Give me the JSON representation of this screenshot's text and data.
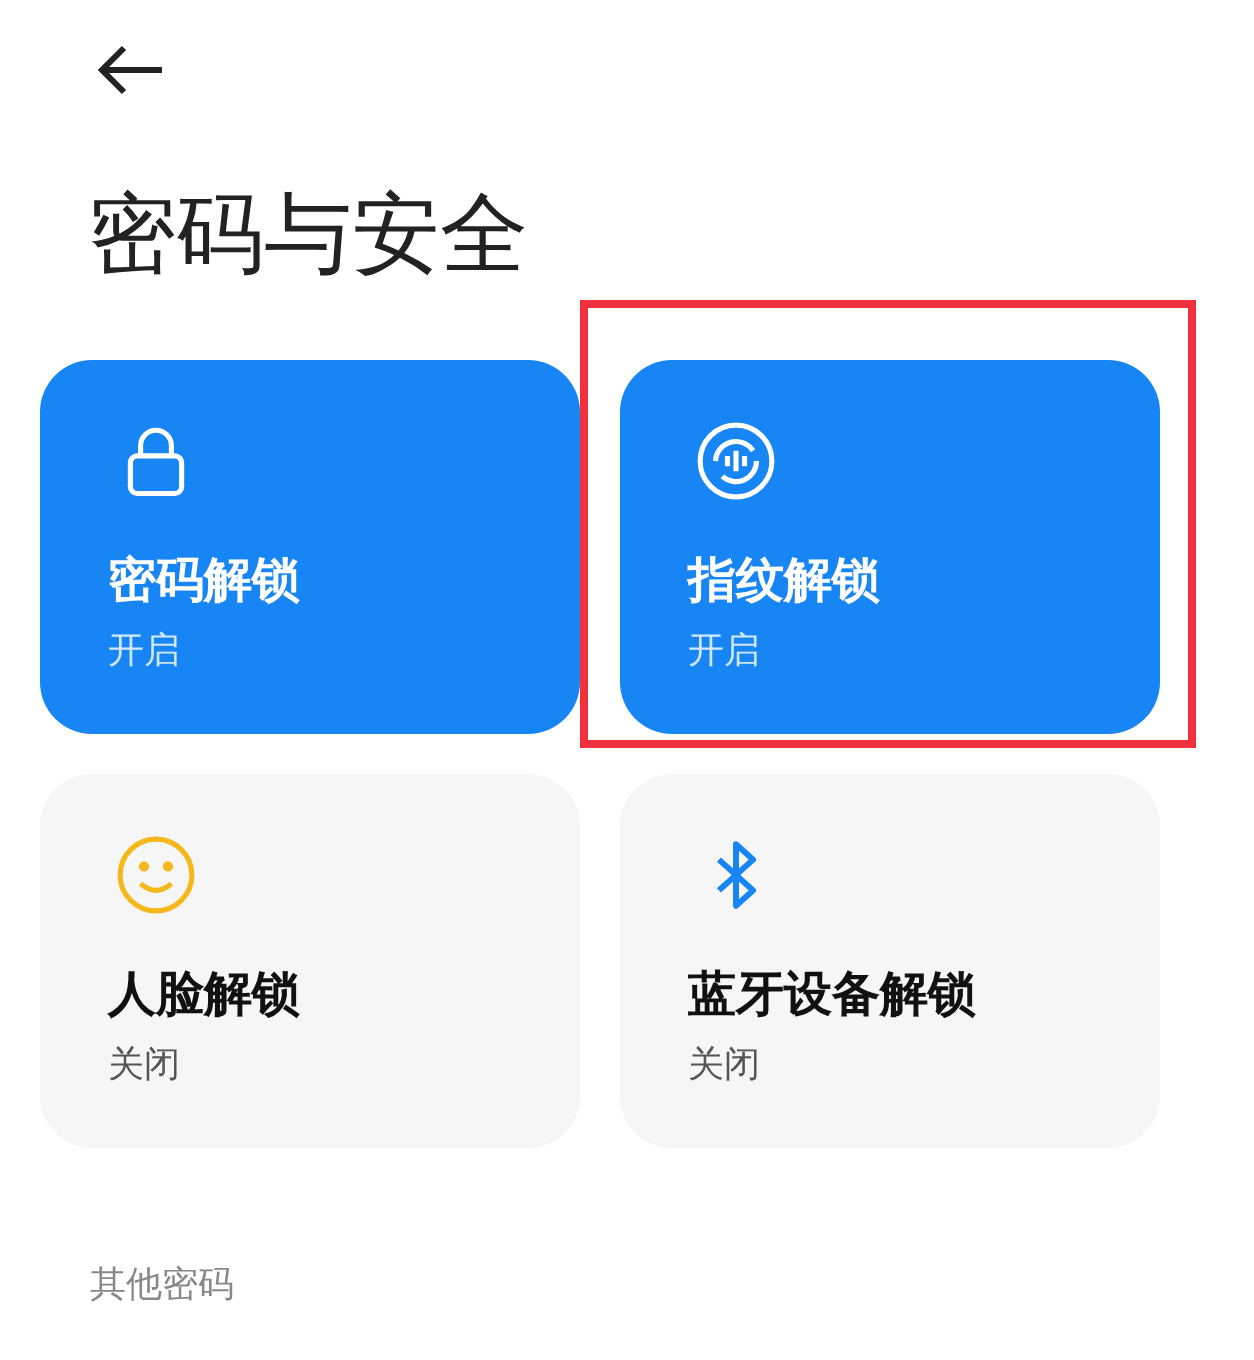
{
  "title": "密码与安全",
  "cards": [
    {
      "kind": "lock",
      "label": "密码解锁",
      "status": "开启",
      "on": true,
      "highlighted": false
    },
    {
      "kind": "fingerprint",
      "label": "指纹解锁",
      "status": "开启",
      "on": true,
      "highlighted": true
    },
    {
      "kind": "face",
      "label": "人脸解锁",
      "status": "关闭",
      "on": false,
      "highlighted": false
    },
    {
      "kind": "bluetooth",
      "label": "蓝牙设备解锁",
      "status": "关闭",
      "on": false,
      "highlighted": false
    }
  ],
  "section_label": "其他密码"
}
